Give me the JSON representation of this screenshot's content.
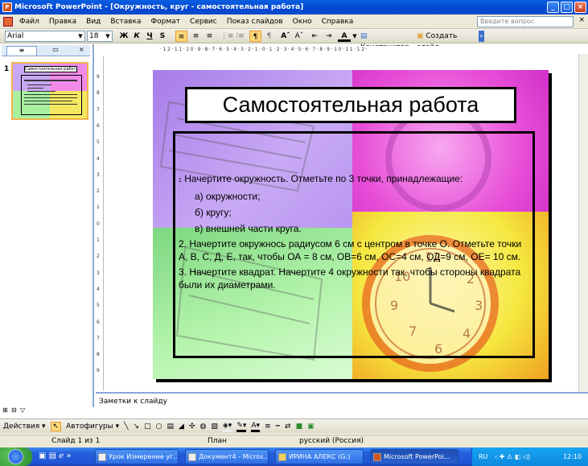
{
  "window": {
    "title": "Microsoft PowerPoint - [Окружность, круг - самостоятельная работа]"
  },
  "menu": {
    "items": [
      "Файл",
      "Правка",
      "Вид",
      "Вставка",
      "Формат",
      "Сервис",
      "Показ слайдов",
      "Окно",
      "Справка"
    ],
    "help_placeholder": "Введите вопрос"
  },
  "toolbar": {
    "font": "Arial",
    "size": "18",
    "bold": "Ж",
    "italic": "К",
    "underline": "Ч",
    "shadow": "S",
    "grow_font": "Aˆ",
    "shrink_font": "Aˇ",
    "designer": "Конструктор",
    "new_slide": "Создать слайд"
  },
  "ruler": {
    "top": "·12·11·10·9·8·7·6·5·4·3·2·1·0·1·2·3·4·5·6·7·8·9·10·11·12·",
    "left": [
      "9",
      "8",
      "7",
      "6",
      "5",
      "4",
      "3",
      "2",
      "1",
      "0",
      "1",
      "2",
      "3",
      "4",
      "5",
      "6",
      "7",
      "8",
      "9"
    ]
  },
  "thumbnail": {
    "number": "1",
    "title": "Самостоятельная работа"
  },
  "slide": {
    "title": "Самостоятельная работа",
    "items": [
      {
        "text": "Начертите окружность. Отметьте по 3 точки, принадлежащие:",
        "indent": 0,
        "bullet": "1"
      },
      {
        "text": "а) окружности;",
        "indent": 1,
        "bullet": ""
      },
      {
        "text": "б) кругу;",
        "indent": 1,
        "bullet": ""
      },
      {
        "text": "в) внешней части круга.",
        "indent": 1,
        "bullet": ""
      },
      {
        "text": "2. Начертите окружнось радиусом 6 см с центром в точке О. Отметьте точки А, В, С, Д, Е, так, чтобы  ОА = 8 см, ОВ=6 см, ОС=4 см, ОД=9 см, ОЕ= 10 см.",
        "indent": 0,
        "bullet": ""
      },
      {
        "text": "3. Начертите квадрат. Начертите 4 окружности так, чтобы стороны квадрата были их диаметрами.",
        "indent": 0,
        "bullet": ""
      }
    ]
  },
  "notes": {
    "placeholder": "Заметки к слайду"
  },
  "drawbar": {
    "actions": "Действия",
    "autoshapes": "Автофигуры"
  },
  "status": {
    "slide": "Слайд 1 из 1",
    "design": "План",
    "language": "русский (Россия)"
  },
  "taskbar": {
    "tasks": [
      {
        "label": "Урок Измерение уг..."
      },
      {
        "label": "Документ4 - Micros..."
      },
      {
        "label": "ИРИНА АЛЕКС (G:)"
      },
      {
        "label": "Microsoft PowerPoi..."
      }
    ],
    "lang": "RU",
    "clock": "12:10"
  },
  "colors": {
    "title_bar": "#0346d2",
    "taskbar": "#245edb",
    "quad_purple": "#b48cf0",
    "quad_magenta": "#f05ae6",
    "quad_green": "#8cf08c",
    "quad_yellow": "#f0f03c"
  }
}
